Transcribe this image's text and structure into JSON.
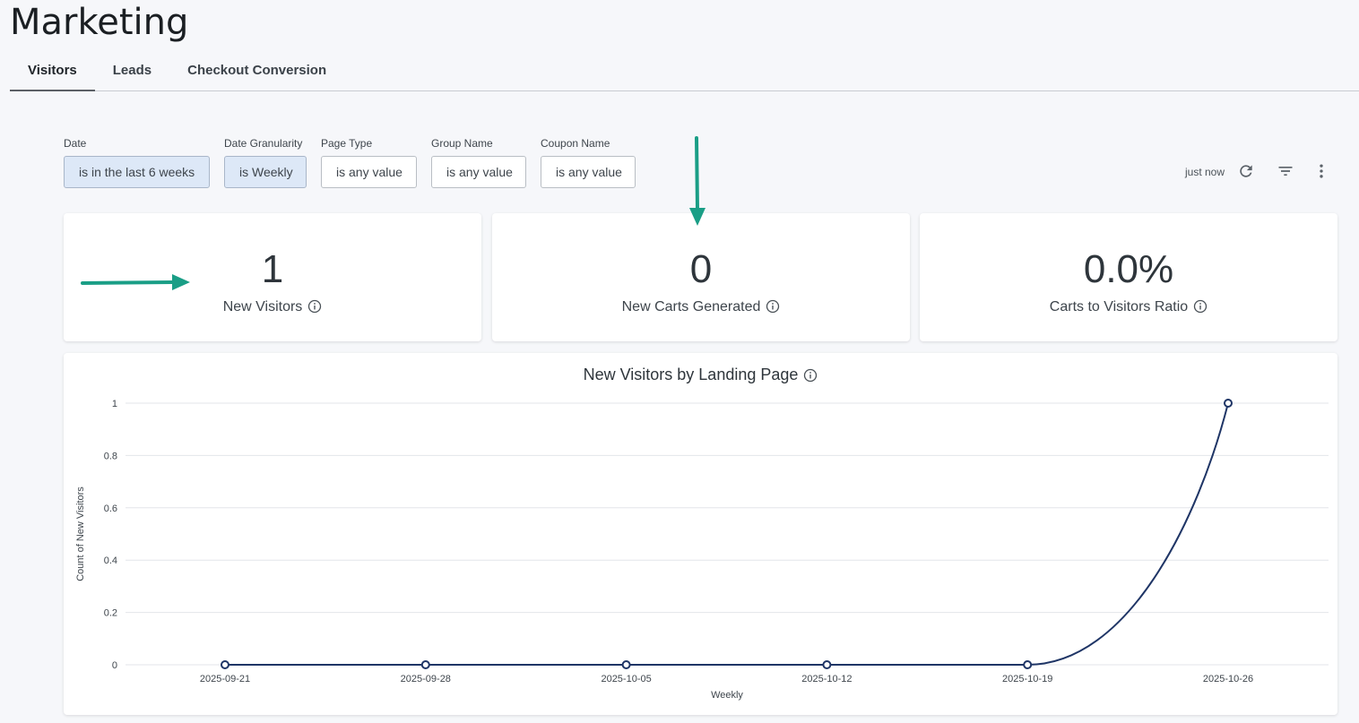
{
  "page": {
    "title": "Marketing"
  },
  "tabs": [
    {
      "label": "Visitors",
      "active": true
    },
    {
      "label": "Leads",
      "active": false
    },
    {
      "label": "Checkout Conversion",
      "active": false
    }
  ],
  "filters": [
    {
      "label": "Date",
      "value": "is in the last 6 weeks",
      "set": true
    },
    {
      "label": "Date Granularity",
      "value": "is Weekly",
      "set": true
    },
    {
      "label": "Page Type",
      "value": "is any value",
      "set": false
    },
    {
      "label": "Group Name",
      "value": "is any value",
      "set": false
    },
    {
      "label": "Coupon Name",
      "value": "is any value",
      "set": false
    }
  ],
  "toolbar": {
    "status": "just now",
    "icons": [
      "refresh-icon",
      "filter-icon",
      "more-vert-icon"
    ]
  },
  "kpis": [
    {
      "value": "1",
      "label": "New Visitors"
    },
    {
      "value": "0",
      "label": "New Carts Generated"
    },
    {
      "value": "0.0%",
      "label": "Carts to Visitors Ratio"
    }
  ],
  "colors": {
    "accent_arrow": "#1a9e86",
    "series_line": "#1f3566",
    "chip_selected": "#dde8f7"
  },
  "chart_data": {
    "type": "line",
    "title": "New Visitors by Landing Page",
    "xlabel": "Weekly",
    "ylabel": "Count of New Visitors",
    "x": [
      "2025-09-21",
      "2025-09-28",
      "2025-10-05",
      "2025-10-12",
      "2025-10-19",
      "2025-10-26"
    ],
    "series": [
      {
        "values": [
          0,
          0,
          0,
          0,
          0,
          1
        ]
      }
    ],
    "yticks": [
      "0",
      "0.2",
      "0.4",
      "0.6",
      "0.8",
      "1"
    ],
    "ylim": [
      0,
      1
    ],
    "grid": true,
    "legend": "none"
  }
}
